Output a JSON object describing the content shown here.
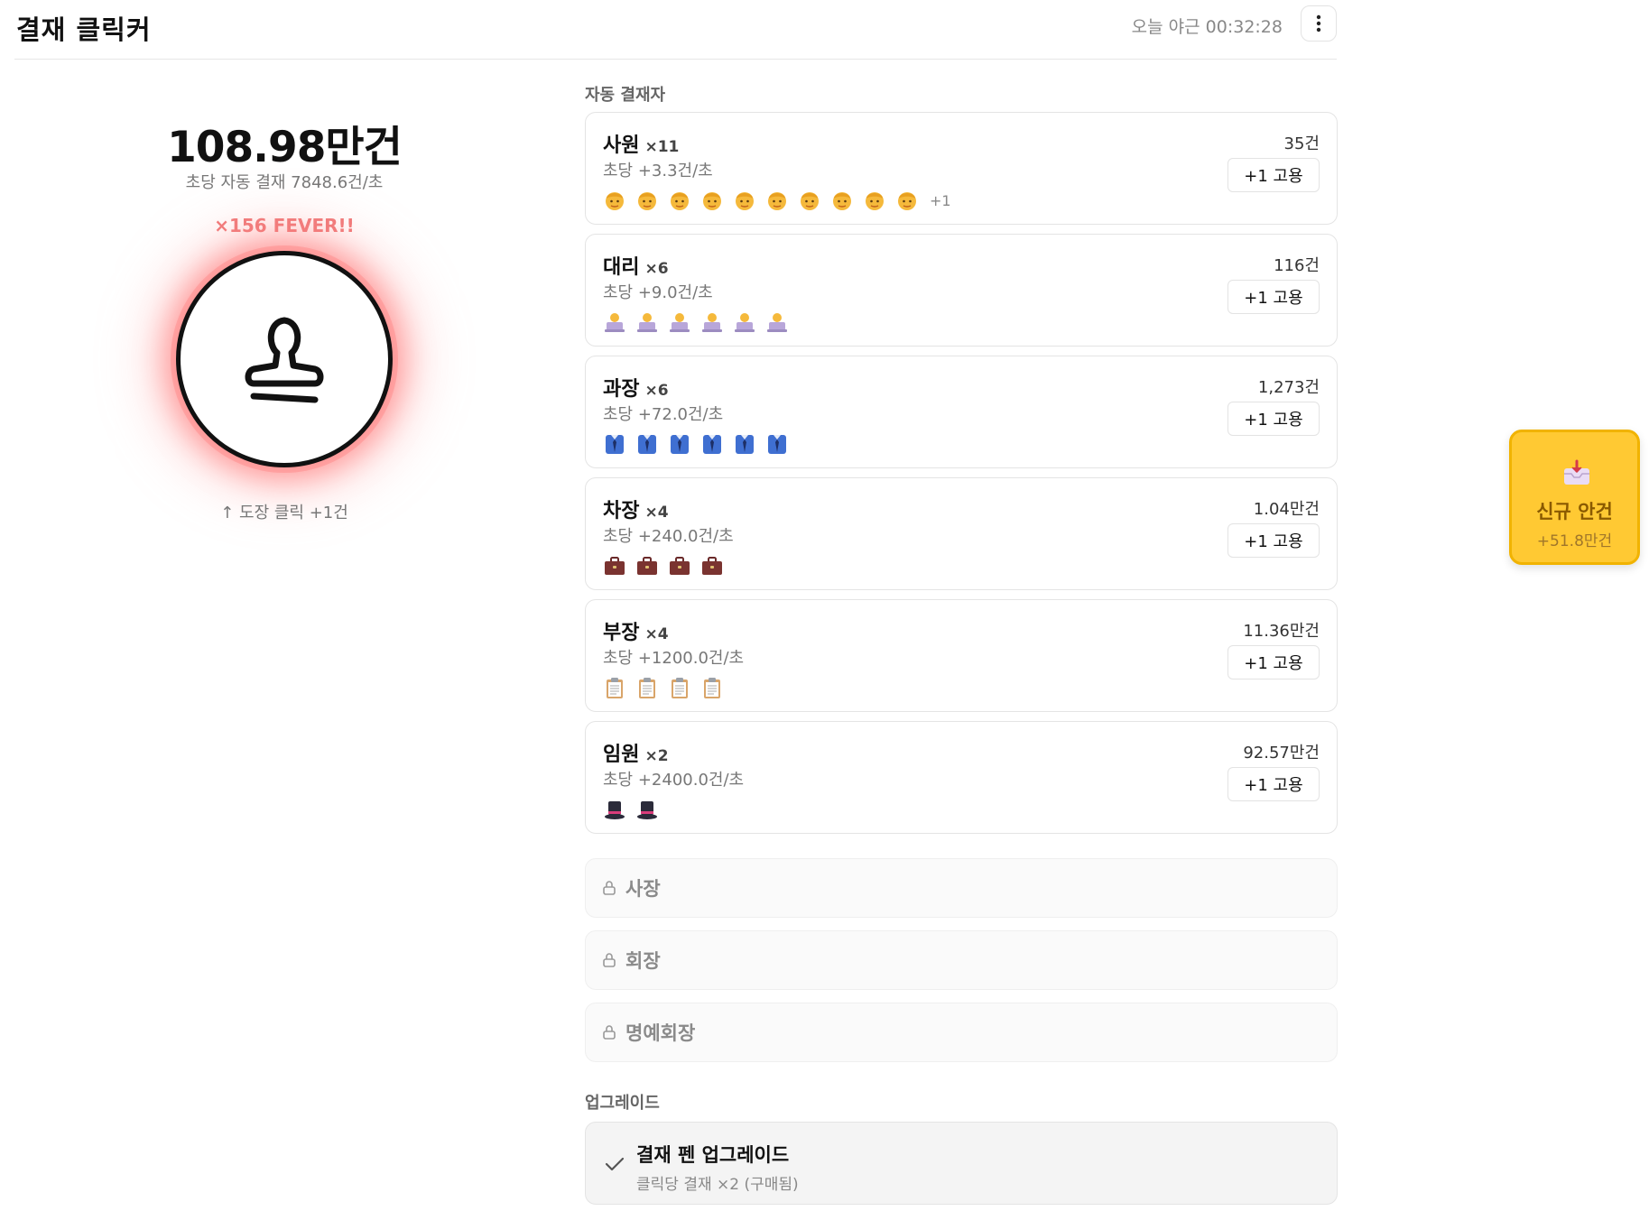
{
  "header": {
    "title": "결재 클릭커",
    "clock": "오늘 야근 00:32:28",
    "menu_icon": "more-vertical-icon"
  },
  "counter": {
    "value": "108.98만건",
    "rate": "초당 자동 결재 7848.6건/초",
    "fever": "×156 FEVER!!",
    "stamp_icon": "stamp-icon",
    "hint": "↑ 도장 클릭 +1건"
  },
  "workers_section": {
    "label": "자동 결재자"
  },
  "workers": [
    {
      "name": "사원",
      "count": "×11",
      "rate": "초당 +3.3건/초",
      "total": "35건",
      "hire": "+1 고용",
      "icon": "man-face-icon",
      "icons_shown": 10,
      "more": "+1"
    },
    {
      "name": "대리",
      "count": "×6",
      "rate": "초당 +9.0건/초",
      "total": "116건",
      "hire": "+1 고용",
      "icon": "laptop-worker-icon",
      "icons_shown": 6,
      "more": ""
    },
    {
      "name": "과장",
      "count": "×6",
      "rate": "초당 +72.0건/초",
      "total": "1,273건",
      "hire": "+1 고용",
      "icon": "suit-tie-icon",
      "icons_shown": 6,
      "more": ""
    },
    {
      "name": "차장",
      "count": "×4",
      "rate": "초당 +240.0건/초",
      "total": "1.04만건",
      "hire": "+1 고용",
      "icon": "briefcase-icon",
      "icons_shown": 4,
      "more": ""
    },
    {
      "name": "부장",
      "count": "×4",
      "rate": "초당 +1200.0건/초",
      "total": "11.36만건",
      "hire": "+1 고용",
      "icon": "clipboard-icon",
      "icons_shown": 4,
      "more": ""
    },
    {
      "name": "임원",
      "count": "×2",
      "rate": "초당 +2400.0건/초",
      "total": "92.57만건",
      "hire": "+1 고용",
      "icon": "top-hat-icon",
      "icons_shown": 2,
      "more": ""
    }
  ],
  "locked": [
    {
      "name": "사장"
    },
    {
      "name": "회장"
    },
    {
      "name": "명예회장"
    }
  ],
  "upgrades_section": {
    "label": "업그레이드"
  },
  "upgrade": {
    "title": "결재 펜 업그레이드",
    "subtitle": "클릭당 결재 ×2 (구매됨)",
    "icon": "check-icon"
  },
  "event": {
    "title": "신규 안건",
    "subtitle": "+51.8만건",
    "icon": "inbox-tray-icon"
  },
  "colors": {
    "fever": "#f07a7a",
    "event_bg": "#ffc933",
    "glow": "#ff7b7b"
  }
}
